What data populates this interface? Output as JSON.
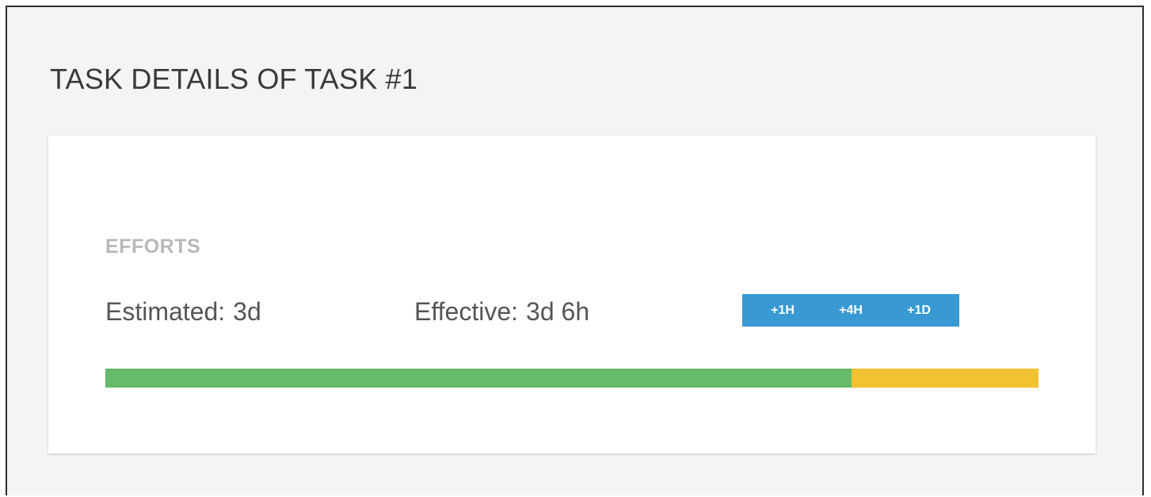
{
  "page": {
    "title": "TASK DETAILS OF TASK #1"
  },
  "efforts": {
    "section_label": "EFFORTS",
    "estimated_label": "Estimated:",
    "estimated_value": "3d",
    "effective_label": "Effective:",
    "effective_value": "3d 6h",
    "buttons": [
      "+1H",
      "+4H",
      "+1D"
    ],
    "progress": {
      "estimated_fraction": 0.8,
      "overrun_fraction": 0.2,
      "on_time_color": "#66bb6a",
      "overrun_color": "#f1c232"
    }
  },
  "colors": {
    "button_bg": "#3899d3",
    "background": "#f4f4f4",
    "card": "#ffffff"
  }
}
